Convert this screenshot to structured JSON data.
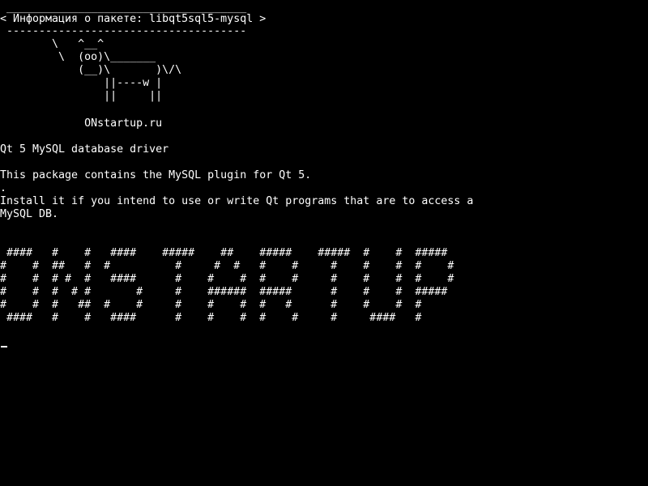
{
  "terminal": {
    "cowsay": {
      "border_top": " _____________________________________",
      "speech": "< Информация о пакете: libqt5sql5-mysql >",
      "border_bottom": " -------------------------------------",
      "cow_line_1": "        \\   ^__^",
      "cow_line_2": "         \\  (oo)\\_______",
      "cow_line_3": "            (__)\\       )\\/\\",
      "cow_line_4": "                ||----w |",
      "cow_line_5": "                ||     ||"
    },
    "site_label": "             ONstartup.ru",
    "package": {
      "summary": "Qt 5 MySQL database driver",
      "description_1": "This package contains the MySQL plugin for Qt 5.",
      "description_dot": ".",
      "description_2": "Install it if you intend to use or write Qt programs that are to access a",
      "description_3": "MySQL DB."
    },
    "banner": {
      "row_1": " ####   #    #   ####    #####    ##    #####    #####  #    #  #####",
      "row_2": "#    #  ##   #  #          #     #  #   #    #     #    #    #  #    #",
      "row_3": "#    #  # #  #   ####      #    #    #  #    #     #    #    #  #    #",
      "row_4": "#    #  #  # #       #     #    ######  #####      #    #    #  #####",
      "row_5": "#    #  #   ##  #    #     #    #    #  #   #      #    #    #  #",
      "row_6": " ####   #    #   ####      #    #    #  #    #     #     ####   #"
    },
    "colors": {
      "background": "#000000",
      "foreground": "#ffffff"
    }
  }
}
